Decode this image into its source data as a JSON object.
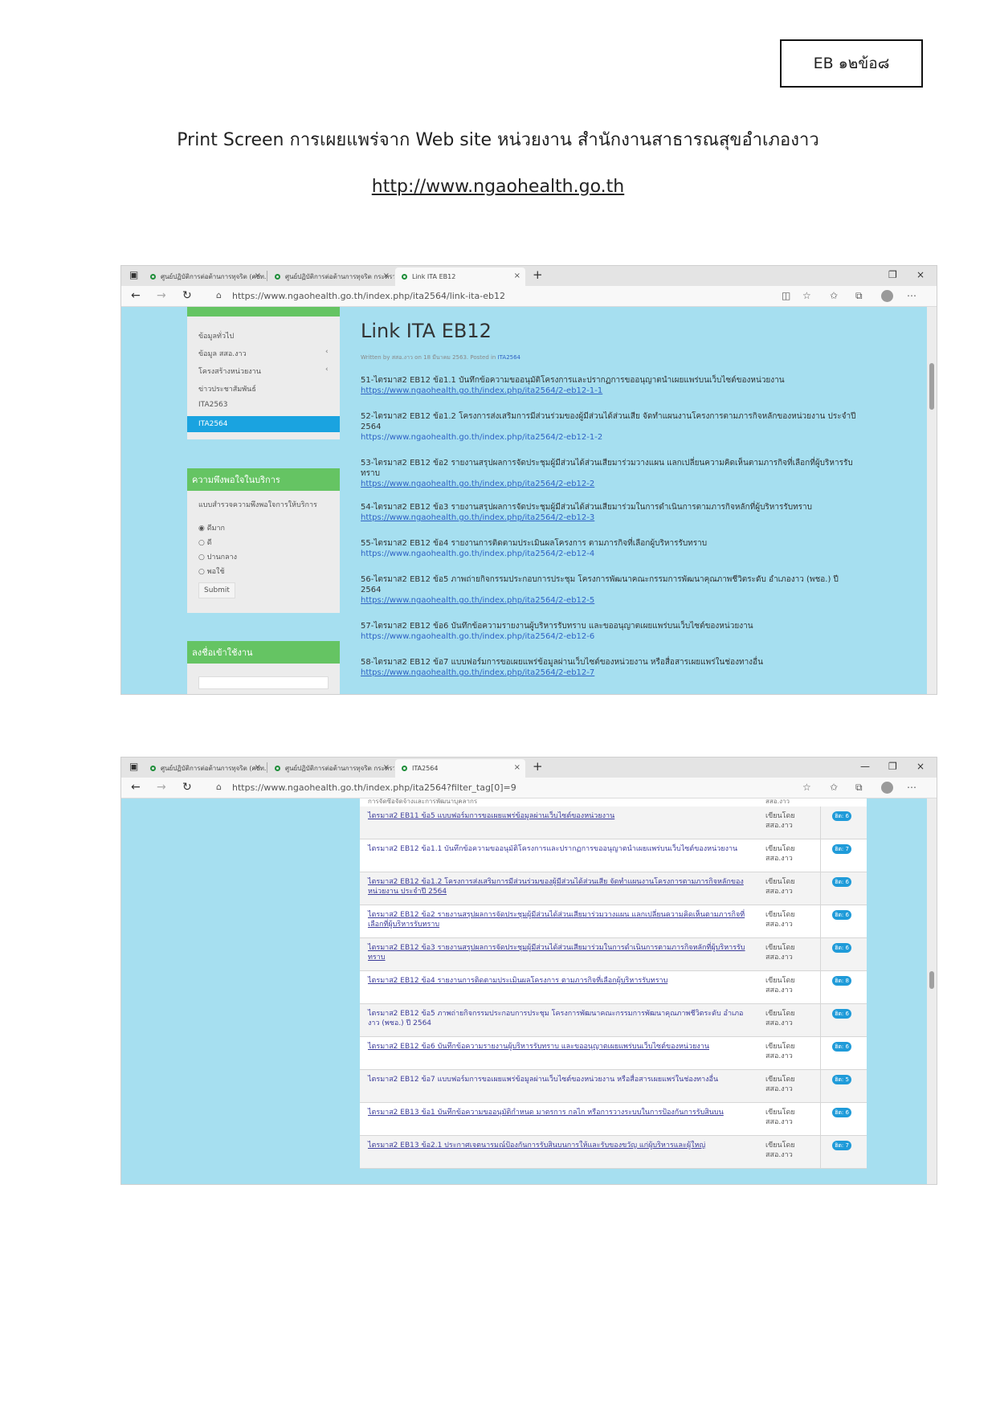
{
  "header": {
    "eb_label": "EB ๑๒ข้อ๘",
    "title": "Print Screen การเผยแพร่จาก Web site หน่วยงาน สำนักงานสาธารณสุขอำเภองาว",
    "url": "http://www.ngaohealth.go.th"
  },
  "screenshot1": {
    "tabs": [
      "ศูนย์ปฏิบัติการต่อต้านการทุจริต (ศปท.)",
      "ศูนย์ปฏิบัติการต่อต้านการทุจริต กระทรวง",
      "Link ITA EB12"
    ],
    "address": "https://www.ngaohealth.go.th/index.php/ita2564/link-ita-eb12",
    "sidebar": {
      "items": [
        "ข้อมูลทั่วไป",
        "ข้อมูล สสอ.งาว",
        "โครงสร้างหน่วยงาน",
        "ข่าวประชาสัมพันธ์",
        "ITA2563"
      ],
      "active": "ITA2564",
      "survey_title": "ความพึงพอใจในบริการ",
      "survey_question": "แบบสำรวจความพึงพอใจการให้บริการ",
      "options": [
        "ดีมาก",
        "ดี",
        "ปานกลาง",
        "พอใช้"
      ],
      "submit": "Submit",
      "login_title": "ลงชื่อเข้าใช้งาน"
    },
    "page_title": "Link ITA EB12",
    "byline_prefix": "Written by สสอ.งาว on 18 มีนาคม 2563. Posted in",
    "byline_tag": "ITA2564",
    "entries": [
      {
        "text": "51-ไตรมาส2 EB12 ข้อ1.1 บันทึกข้อความขออนุมัติโครงการและปรากฏการขออนุญาตนำเผยแพร่บนเว็บไซต์ของหน่วยงาน",
        "link": "https://www.ngaohealth.go.th/index.php/ita2564/2-eb12-1-1"
      },
      {
        "text": "52-ไตรมาส2 EB12 ข้อ1.2 โครงการส่งเสริมการมีส่วนร่วมของผู้มีส่วนได้ส่วนเสีย จัดทำแผนงานโครงการตามภารกิจหลักของหน่วยงาน ประจำปี 2564",
        "link": "https://www.ngaohealth.go.th/index.php/ita2564/2-eb12-1-2"
      },
      {
        "text": "53-ไตรมาส2 EB12 ข้อ2 รายงานสรุปผลการจัดประชุมผู้มีส่วนได้ส่วนเสียมาร่วมวางแผน แลกเปลี่ยนความคิดเห็นตามภารกิจที่เลือกที่ผู้บริหารรับทราบ",
        "link": "https://www.ngaohealth.go.th/index.php/ita2564/2-eb12-2"
      },
      {
        "text": "54-ไตรมาส2 EB12 ข้อ3 รายงานสรุปผลการจัดประชุมผู้มีส่วนได้ส่วนเสียมาร่วมในการดำเนินการตามภารกิจหลักที่ผู้บริหารรับทราบ",
        "link": "https://www.ngaohealth.go.th/index.php/ita2564/2-eb12-3"
      },
      {
        "text": "55-ไตรมาส2 EB12 ข้อ4 รายงานการติดตามประเมินผลโครงการ ตามภารกิจที่เลือกผู้บริหารรับทราบ",
        "link": "https://www.ngaohealth.go.th/index.php/ita2564/2-eb12-4"
      },
      {
        "text": "56-ไตรมาส2 EB12 ข้อ5 ภาพถ่ายกิจกรรมประกอบการประชุม โครงการพัฒนาคณะกรรมการพัฒนาคุณภาพชีวิตระดับ อำเภองาว (พชอ.) ปี 2564",
        "link": "https://www.ngaohealth.go.th/index.php/ita2564/2-eb12-5"
      },
      {
        "text": "57-ไตรมาส2 EB12 ข้อ6 บันทึกข้อความรายงานผู้บริหารรับทราบ และขออนุญาตเผยแพร่บนเว็บไซต์ของหน่วยงาน",
        "link": "https://www.ngaohealth.go.th/index.php/ita2564/2-eb12-6"
      },
      {
        "text": "58-ไตรมาส2 EB12 ข้อ7 แบบฟอร์มการขอเผยแพร่ข้อมูลผ่านเว็บไซต์ของหน่วยงาน หรือสื่อสารเผยแพร่ในช่องทางอื่น",
        "link": "https://www.ngaohealth.go.th/index.php/ita2564/2-eb12-7"
      }
    ]
  },
  "screenshot2": {
    "tabs": [
      "ศูนย์ปฏิบัติการต่อต้านการทุจริต (ศปท.)",
      "ศูนย์ปฏิบัติการต่อต้านการทุจริต กระทรวง",
      "ITA2564"
    ],
    "address": "https://www.ngaohealth.go.th/index.php/ita2564?filter_tag[0]=9",
    "top_partial": "การจัดซื้อจัดจ้างและการพัฒนาบุคลากร",
    "top_partial_by": "สสอ.งาว",
    "rows": [
      {
        "title": "ไตรมาส2 EB11 ข้อ5 แบบฟอร์มการขอเผยแพร่ข้อมูลผ่านเว็บไซต์ของหน่วยงาน",
        "by1": "เขียนโดย",
        "by2": "สสอ.งาว",
        "hits": "ฮิต: 6"
      },
      {
        "title": "ไตรมาส2 EB12 ข้อ1.1 บันทึกข้อความขออนุมัติโครงการและปรากฏการขออนุญาตนำเผยแพร่บนเว็บไซต์ของหน่วยงาน",
        "by1": "เขียนโดย",
        "by2": "สสอ.งาว",
        "hits": "ฮิต: 7"
      },
      {
        "title": "ไตรมาส2 EB12 ข้อ1.2 โครงการส่งเสริมการมีส่วนร่วมของผู้มีส่วนได้ส่วนเสีย จัดทำแผนงานโครงการตามภารกิจหลักของหน่วยงาน ประจำปี 2564",
        "by1": "เขียนโดย",
        "by2": "สสอ.งาว",
        "hits": "ฮิต: 6"
      },
      {
        "title": "ไตรมาส2 EB12 ข้อ2 รายงานสรุปผลการจัดประชุมผู้มีส่วนได้ส่วนเสียมาร่วมวางแผน แลกเปลี่ยนความคิดเห็นตามภารกิจที่เลือกที่ผู้บริหารรับทราบ",
        "by1": "เขียนโดย",
        "by2": "สสอ.งาว",
        "hits": "ฮิต: 6"
      },
      {
        "title": "ไตรมาส2 EB12 ข้อ3 รายงานสรุปผลการจัดประชุมผู้มีส่วนได้ส่วนเสียมาร่วมในการดำเนินการตามภารกิจหลักที่ผู้บริหารรับทราบ",
        "by1": "เขียนโดย",
        "by2": "สสอ.งาว",
        "hits": "ฮิต: 6"
      },
      {
        "title": "ไตรมาส2 EB12 ข้อ4 รายงานการติดตามประเมินผลโครงการ ตามภารกิจที่เลือกผู้บริหารรับทราบ",
        "by1": "เขียนโดย",
        "by2": "สสอ.งาว",
        "hits": "ฮิต: 8"
      },
      {
        "title": "ไตรมาส2 EB12 ข้อ5 ภาพถ่ายกิจกรรมประกอบการประชุม โครงการพัฒนาคณะกรรมการพัฒนาคุณภาพชีวิตระดับ อำเภองาว (พชอ.) ปี 2564",
        "by1": "เขียนโดย",
        "by2": "สสอ.งาว",
        "hits": "ฮิต: 6"
      },
      {
        "title": "ไตรมาส2 EB12 ข้อ6 บันทึกข้อความรายงานผู้บริหารรับทราบ และขออนุญาตเผยแพร่บนเว็บไซต์ของหน่วยงาน",
        "by1": "เขียนโดย",
        "by2": "สสอ.งาว",
        "hits": "ฮิต: 6"
      },
      {
        "title": "ไตรมาส2 EB12 ข้อ7 แบบฟอร์มการขอเผยแพร่ข้อมูลผ่านเว็บไซต์ของหน่วยงาน หรือสื่อสารเผยแพร่ในช่องทางอื่น",
        "by1": "เขียนโดย",
        "by2": "สสอ.งาว",
        "hits": "ฮิต: 5"
      },
      {
        "title": "ไตรมาส2 EB13 ข้อ1 บันทึกข้อความขออนุมัติกำหนด มาตรการ กลไก หรือการวางระบบในการป้องกันการรับสินบน",
        "by1": "เขียนโดย",
        "by2": "สสอ.งาว",
        "hits": "ฮิต: 6"
      },
      {
        "title": "ไตรมาส2 EB13 ข้อ2.1 ประกาศเจตนารมณ์ป้องกันการรับสินบนการให้และรับของขวัญ แก่ผู้บริหารและผู้ใหญ่",
        "by1": "เขียนโดย",
        "by2": "สสอ.งาว",
        "hits": "ฮิต: 7"
      }
    ]
  }
}
